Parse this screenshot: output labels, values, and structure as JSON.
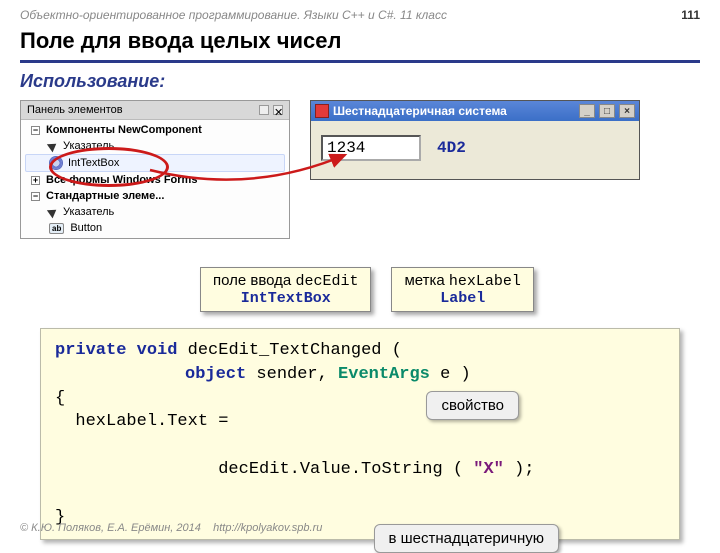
{
  "header": {
    "course": "Объектно-ориентированное программирование. Языки C++ и C#. 11 класс",
    "page": "111"
  },
  "title": "Поле для ввода целых чисел",
  "subhead": "Использование:",
  "toolbox": {
    "title": "Панель элементов",
    "cat1": "Компоненты NewComponent",
    "item_pointer": "Указатель",
    "item_inttextbox": "IntTextBox",
    "cat2": "Все формы Windows Forms",
    "cat3": "Стандартные элеме...",
    "item_pointer2": "Указатель",
    "item_button": "Button"
  },
  "appwin": {
    "title": "Шестнадцатеричная система",
    "input_value": "1234",
    "hex_out": "4D2"
  },
  "callout1": {
    "l1a": "поле ввода ",
    "l1b": "decEdit",
    "l2": "IntTextBox"
  },
  "callout2": {
    "l1a": "метка ",
    "l1b": "hexLabel",
    "l2": "Label"
  },
  "code": {
    "l1a": "private",
    "l1b": "void",
    "l1c": " decEdit_TextChanged ( ",
    "l2a": "object",
    "l2b": " sender, ",
    "l2c": "EventArgs",
    "l2d": " e )",
    "l3": "{",
    "l4": "  hexLabel.Text = ",
    "l5a": "          decEdit.Value.ToString ( ",
    "l5b": "\"X\"",
    "l5c": " );",
    "l6": "}"
  },
  "tags": {
    "prop": "свойство",
    "tohex": "в шестнадцатеричную"
  },
  "footer": {
    "copy": "© К.Ю. Поляков, Е.А. Ерёмин, 2014",
    "url": "http://kpolyakov.spb.ru"
  }
}
